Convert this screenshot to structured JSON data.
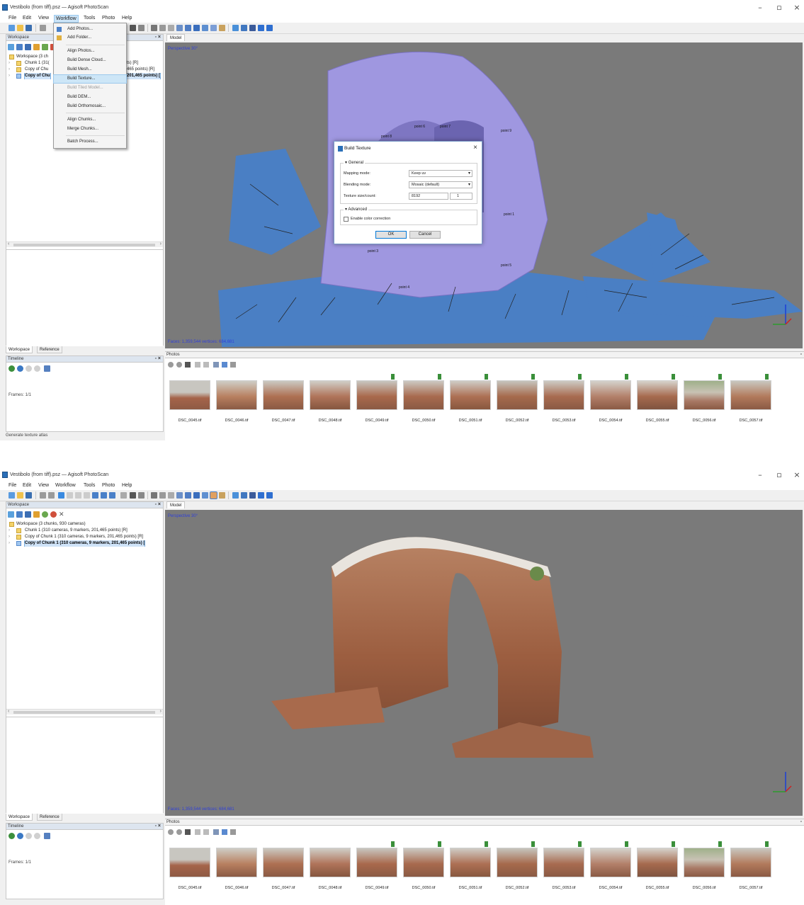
{
  "app": {
    "title": "Vestibolo (from tiff).psz — Agisoft PhotoScan",
    "window_controls": {
      "minimize": "–",
      "maximize": "▫",
      "close": "×"
    },
    "menu": [
      "File",
      "Edit",
      "View",
      "Workflow",
      "Tools",
      "Photo",
      "Help"
    ],
    "active_menu": "Workflow"
  },
  "workflow_menu": {
    "items": [
      {
        "label": "Add Photos...",
        "state": "normal"
      },
      {
        "label": "Add Folder...",
        "state": "normal"
      },
      {
        "label": "Align Photos...",
        "state": "normal"
      },
      {
        "label": "Build Dense Cloud...",
        "state": "normal"
      },
      {
        "label": "Build Mesh...",
        "state": "normal"
      },
      {
        "label": "Build Texture...",
        "state": "highlight"
      },
      {
        "label": "Build Tiled Model...",
        "state": "disabled"
      },
      {
        "label": "Build DEM...",
        "state": "normal"
      },
      {
        "label": "Build Orthomosaic...",
        "state": "normal"
      },
      {
        "label": "Align Chunks...",
        "state": "normal"
      },
      {
        "label": "Merge Chunks...",
        "state": "normal"
      },
      {
        "label": "Batch Process...",
        "state": "normal"
      }
    ]
  },
  "workspace": {
    "title": "Workspace",
    "tree_top": {
      "root": "Workspace (3 ch",
      "items": [
        "Chunk 1 (31(",
        "Copy of Chu",
        "Copy of Chu"
      ],
      "right_fragments": [
        "ts) [R]",
        "465 points) [R]",
        "201,465 points) ["
      ]
    },
    "tree_bottom": {
      "root": "Workspace (3 chunks, 930 cameras)",
      "items": [
        "Chunk 1 (310 cameras, 9 markers, 201,465 points) [R]",
        "Copy of Chunk 1 (310 cameras, 9 markers, 201,465 points) [R]",
        "Copy of Chunk 1 (310 cameras, 9 markers, 201,465 points) ["
      ]
    }
  },
  "tabs": {
    "workspace": "Workspace",
    "reference": "Reference"
  },
  "timeline": {
    "title": "Timeline",
    "frames": "Frames: 1/1"
  },
  "status_top": "Generate texture atlas",
  "viewport": {
    "tab": "Model",
    "label": "Perspective 30°",
    "stats": "Faces: 1,359,544 vertices: 684,681",
    "markers": [
      "point 6",
      "point 7",
      "point 8",
      "point 9",
      "point 1",
      "point 3",
      "point 5",
      "point 4"
    ]
  },
  "dialog": {
    "title": "Build Texture",
    "general": "General",
    "mapping_label": "Mapping mode:",
    "mapping_value": "Keep uv",
    "blending_label": "Blending mode:",
    "blending_value": "Mosaic (default)",
    "texsize_label": "Texture size/count:",
    "texsize_value": "8192",
    "count_value": "1",
    "advanced": "Advanced",
    "color_correction": "Enable color correction",
    "ok": "OK",
    "cancel": "Cancel"
  },
  "photos": {
    "title": "Photos",
    "items": [
      "DSC_0045.tif",
      "DSC_0046.tif",
      "DSC_0047.tif",
      "DSC_0048.tif",
      "DSC_0049.tif",
      "DSC_0050.tif",
      "DSC_0051.tif",
      "DSC_0052.tif",
      "DSC_0053.tif",
      "DSC_0054.tif",
      "DSC_0055.tif",
      "DSC_0056.tif",
      "DSC_0057.tif"
    ]
  },
  "colors": {
    "mesh": "#9f97e0",
    "cameras": "#4a7fc4",
    "viewport_bg": "#7a7a7a",
    "accent": "#cde6f7"
  }
}
